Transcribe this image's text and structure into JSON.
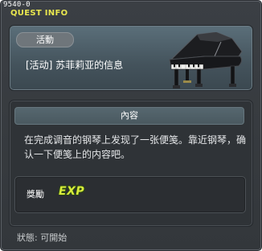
{
  "window": {
    "quest_code": "9540-0",
    "title": "QUEST INFO"
  },
  "quest": {
    "category": "活動",
    "name": "[活动] 苏菲莉亚的信息",
    "image_icon": "grand-piano-icon"
  },
  "content": {
    "header": "內容",
    "description": "在完成调音的钢琴上发现了一张便笺。靠近钢琴，确认一下便笺上的内容吧。"
  },
  "reward": {
    "label": "獎勵",
    "exp_text": "EXP"
  },
  "status": {
    "text": "狀態:  可開始"
  },
  "colors": {
    "title_yellow": "#e8e64f",
    "exp_green_yellow": "#d9ec3c",
    "panel_blue_gray": "#4a5960",
    "frame_dark": "#33373b"
  }
}
